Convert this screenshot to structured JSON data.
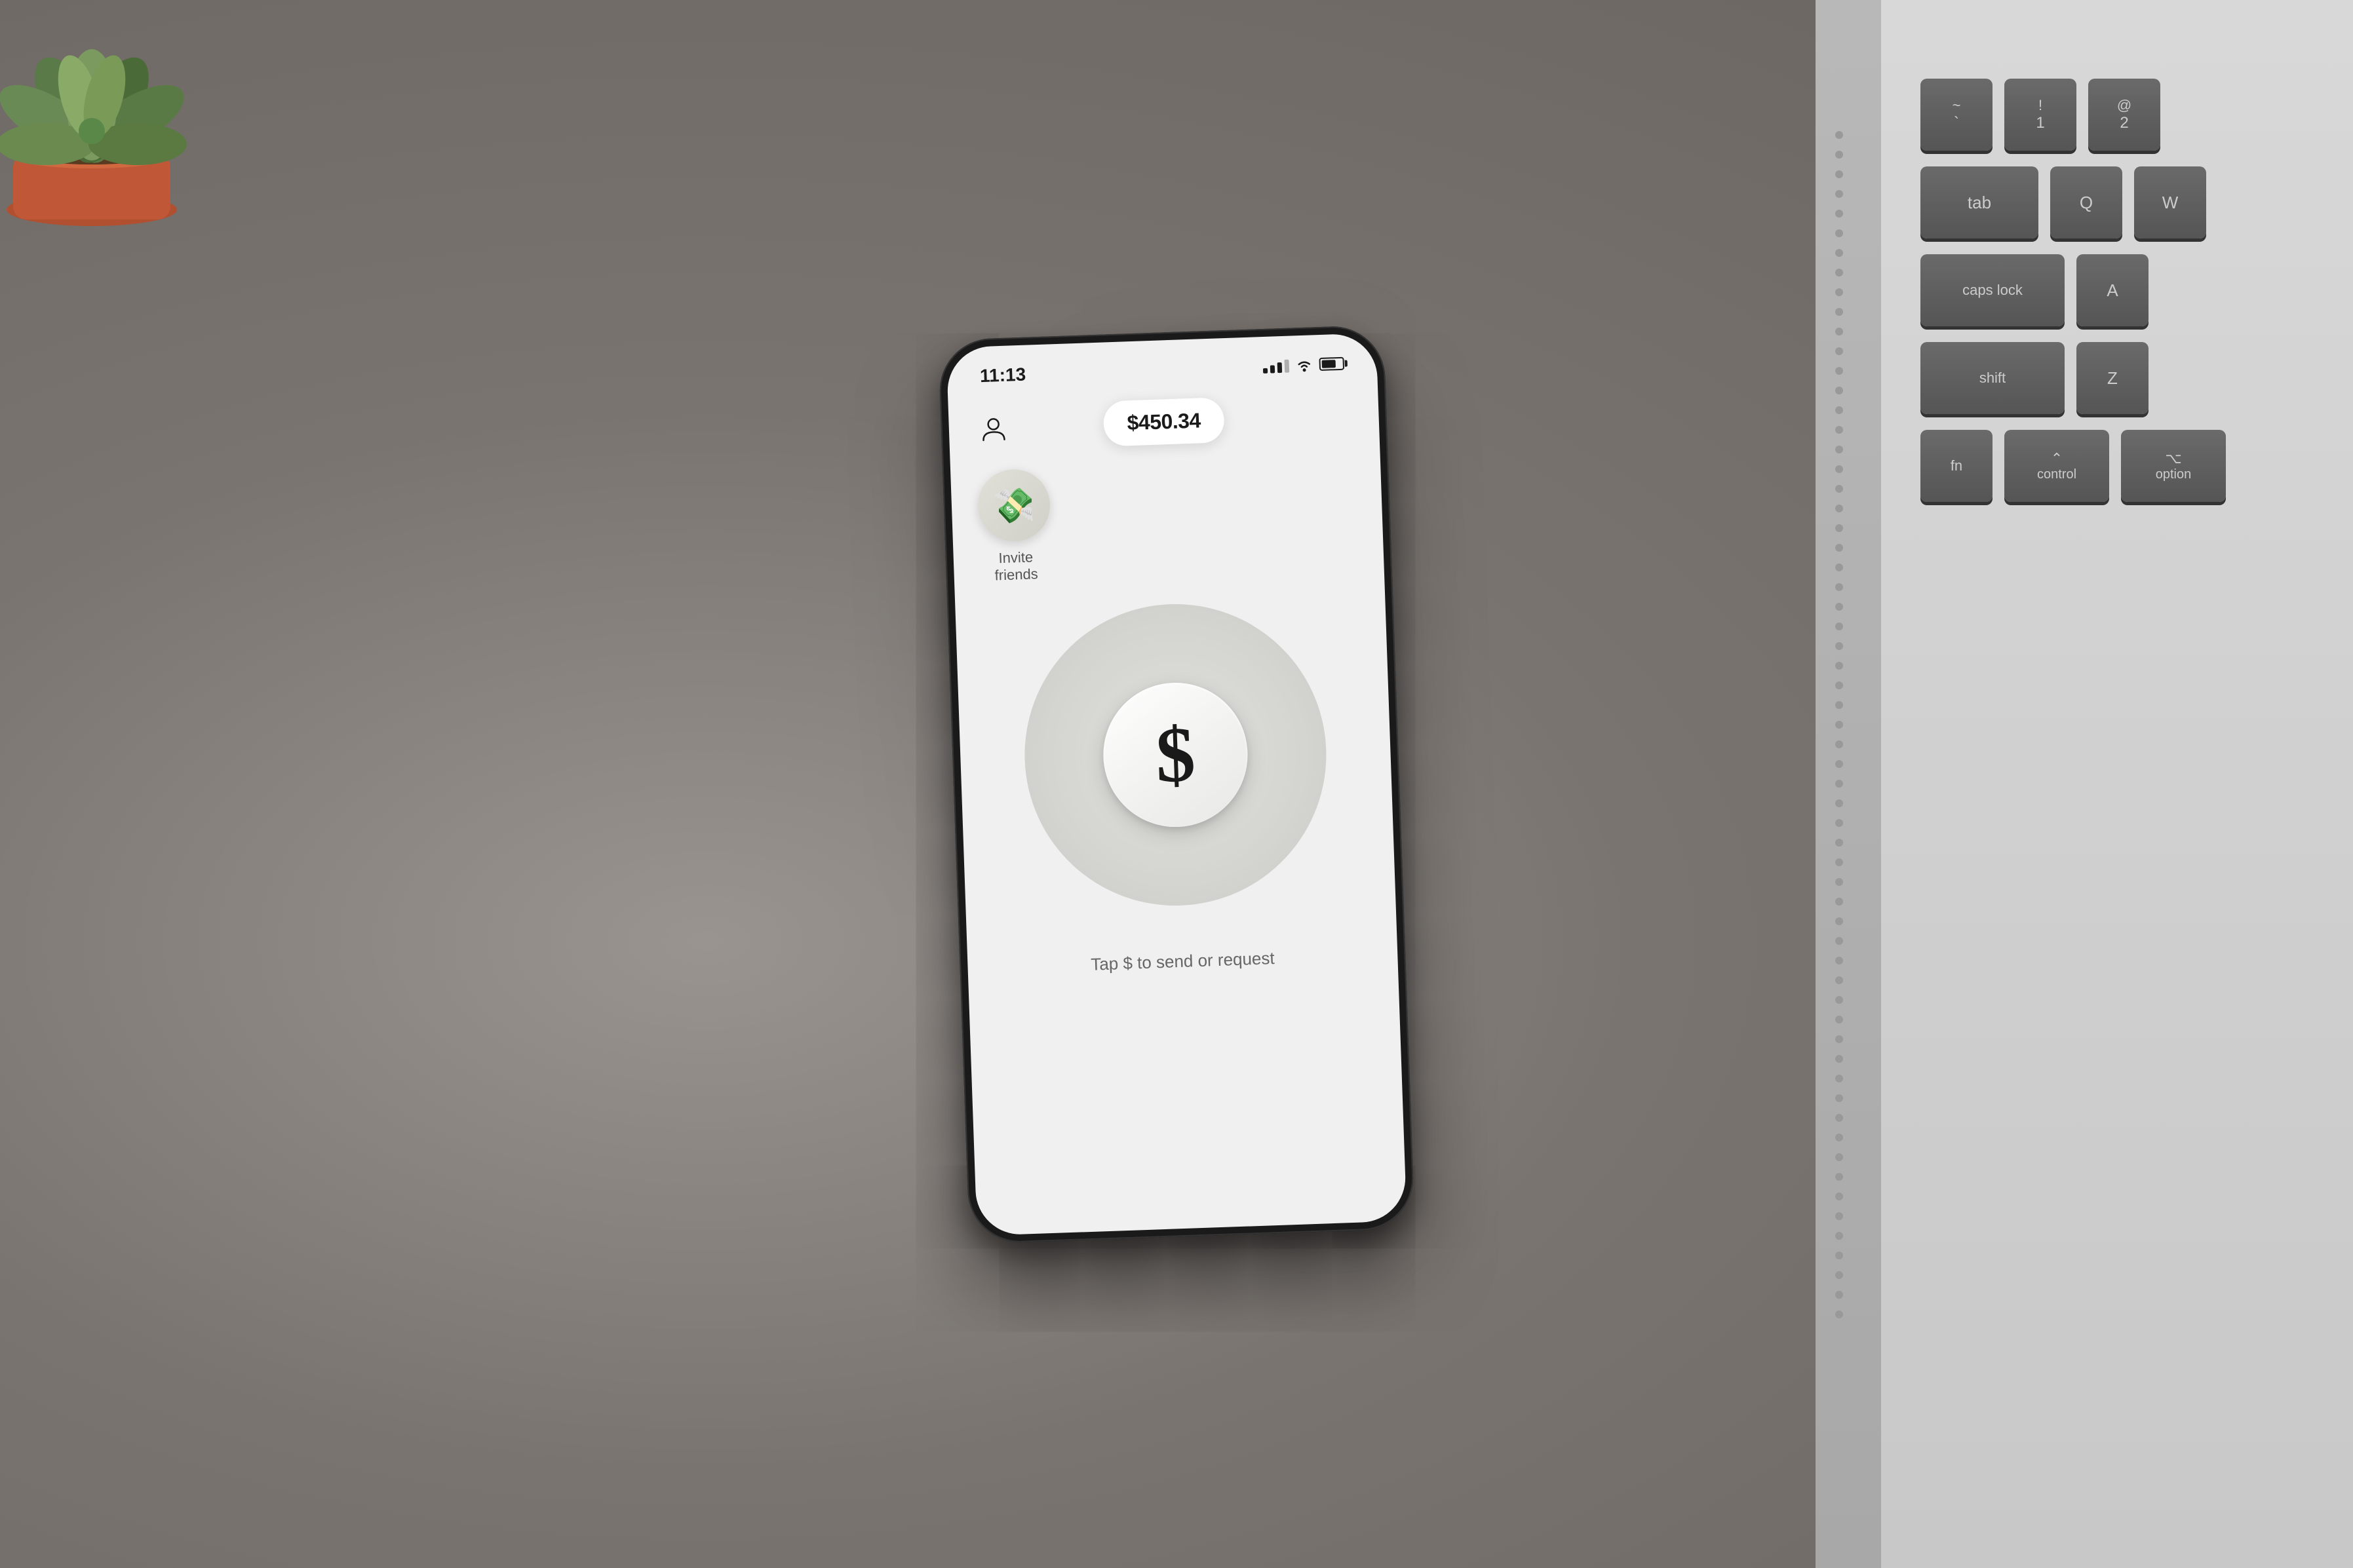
{
  "background": {
    "color": "#8a8480"
  },
  "phone": {
    "status_bar": {
      "time": "11:13",
      "signal": "●●●",
      "wifi": "WiFi",
      "battery": "70%"
    },
    "app": {
      "balance": "$450.34",
      "invite_label": "Invite friends",
      "invite_emoji": "💸",
      "dollar_symbol": "$",
      "tap_instruction": "Tap $ to send or request"
    }
  },
  "keyboard": {
    "rows": [
      [
        {
          "top": "~",
          "bottom": "`"
        },
        {
          "top": "!",
          "bottom": "1"
        },
        {
          "top": "@",
          "bottom": "2"
        }
      ],
      [
        {
          "top": "",
          "bottom": "tab",
          "wide": true
        },
        {
          "top": "",
          "bottom": "Q"
        },
        {
          "top": "",
          "bottom": "W"
        }
      ],
      [
        {
          "top": "",
          "bottom": "caps lock",
          "wide": true
        },
        {
          "top": "",
          "bottom": "A"
        }
      ],
      [
        {
          "top": "",
          "bottom": "shift",
          "wide": true
        },
        {
          "top": "",
          "bottom": "Z"
        }
      ],
      [
        {
          "top": "",
          "bottom": "fn"
        },
        {
          "top": "",
          "bottom": "control"
        },
        {
          "top": "",
          "bottom": "option"
        }
      ]
    ]
  },
  "option_key_label": "option"
}
